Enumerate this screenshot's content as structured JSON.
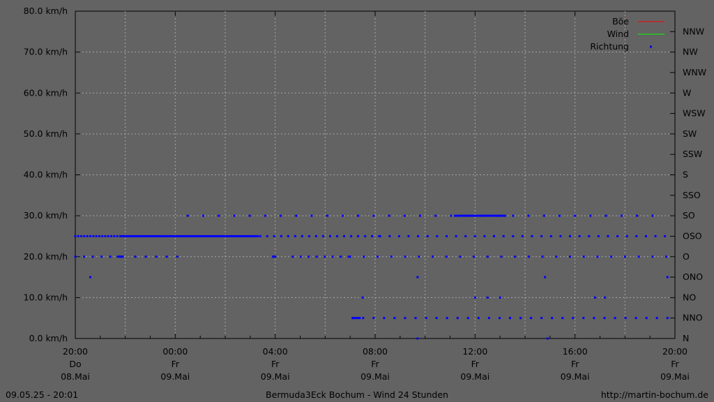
{
  "chart_data": {
    "type": "scatter",
    "title": "Bermuda3Eck Bochum - Wind 24 Stunden",
    "y_ticks": [
      "0.0 km/h",
      "10.0 km/h",
      "20.0 km/h",
      "30.0 km/h",
      "40.0 km/h",
      "50.0 km/h",
      "60.0 km/h",
      "70.0 km/h",
      "80.0 km/h"
    ],
    "ylim": [
      0,
      80
    ],
    "y2_ticks": [
      "N",
      "NNO",
      "NO",
      "ONO",
      "O",
      "OSO",
      "SO",
      "SSO",
      "S",
      "SSW",
      "SW",
      "WSW",
      "W",
      "WNW",
      "NW",
      "NNW"
    ],
    "x_range_hours": [
      0,
      24
    ],
    "x_ticks": [
      {
        "time": "20:00",
        "day": "Do",
        "date": "08.Mai"
      },
      {
        "time": "00:00",
        "day": "Fr",
        "date": "09.Mai"
      },
      {
        "time": "04:00",
        "day": "Fr",
        "date": "09.Mai"
      },
      {
        "time": "08:00",
        "day": "Fr",
        "date": "09.Mai"
      },
      {
        "time": "12:00",
        "day": "Fr",
        "date": "09.Mai"
      },
      {
        "time": "16:00",
        "day": "Fr",
        "date": "09.Mai"
      },
      {
        "time": "20:00",
        "day": "Fr",
        "date": "09.Mai"
      }
    ],
    "grid": true,
    "legend_position": "top-right",
    "colors": {
      "gust": "#ff0000",
      "wind": "#00ff00",
      "direction": "#0000ff"
    },
    "series": [
      {
        "name": "Böe",
        "kind": "line",
        "values": []
      },
      {
        "name": "Wind",
        "kind": "line",
        "values": []
      },
      {
        "name": "Richtung",
        "kind": "points",
        "axis": "direction",
        "runs": [
          {
            "hours": [
              0.0,
              1.7
            ],
            "dir": "OSO",
            "step": 0.12
          },
          {
            "hours": [
              1.8,
              7.3
            ],
            "dir": "OSO",
            "step": 0.05
          },
          {
            "hours": [
              7.4,
              12.2
            ],
            "dir": "OSO",
            "step": 0.28
          },
          {
            "hours": [
              12.2,
              23.9
            ],
            "dir": "OSO",
            "step": 0.38
          },
          {
            "hours": [
              0.0,
              1.7
            ],
            "dir": "O",
            "step": 0.35
          },
          {
            "hours": [
              1.7,
              1.9
            ],
            "dir": "O",
            "step": 0.05
          },
          {
            "hours": [
              2.4,
              4.2
            ],
            "dir": "O",
            "step": 0.42
          },
          {
            "hours": [
              7.9,
              8.0
            ],
            "dir": "O",
            "step": 0.05
          },
          {
            "hours": [
              8.7,
              11.0
            ],
            "dir": "O",
            "step": 0.32
          },
          {
            "hours": [
              11.0,
              23.9
            ],
            "dir": "O",
            "step": 0.55
          },
          {
            "hours": [
              4.5,
              23.6
            ],
            "dir": "SO",
            "step": 0.62
          },
          {
            "hours": [
              15.2,
              17.2
            ],
            "dir": "SO",
            "step": 0.08
          },
          {
            "hours": [
              11.1,
              23.9
            ],
            "dir": "NNO",
            "step": 0.42
          },
          {
            "hours": [
              11.1,
              11.4
            ],
            "dir": "NNO",
            "step": 0.07
          }
        ],
        "points": [
          {
            "hour": 0.6,
            "dir": "ONO"
          },
          {
            "hour": 13.7,
            "dir": "ONO"
          },
          {
            "hour": 18.8,
            "dir": "ONO"
          },
          {
            "hour": 23.7,
            "dir": "ONO"
          },
          {
            "hour": 11.5,
            "dir": "NO"
          },
          {
            "hour": 16.0,
            "dir": "NO"
          },
          {
            "hour": 16.5,
            "dir": "NO"
          },
          {
            "hour": 17.0,
            "dir": "NO"
          },
          {
            "hour": 20.8,
            "dir": "NO"
          },
          {
            "hour": 21.2,
            "dir": "NO"
          },
          {
            "hour": 13.7,
            "dir": "N"
          },
          {
            "hour": 18.9,
            "dir": "N"
          }
        ]
      }
    ]
  },
  "footer": {
    "left": "09.05.25 - 20:01",
    "center": "Bermuda3Eck Bochum - Wind 24 Stunden",
    "right": "http://martin-bochum.de"
  }
}
